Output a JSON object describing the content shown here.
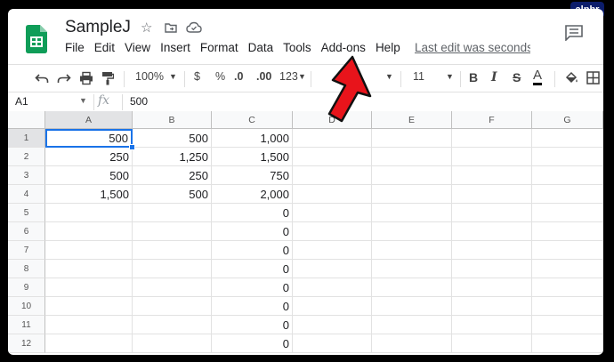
{
  "doc": {
    "title": "SampleJ",
    "last_edit": "Last edit was seconds ago"
  },
  "menu": [
    "File",
    "Edit",
    "View",
    "Insert",
    "Format",
    "Data",
    "Tools",
    "Add-ons",
    "Help"
  ],
  "toolbar": {
    "zoom": "100%",
    "currency": "$",
    "percent": "%",
    "dec_decrease": ".0",
    "dec_increase": ".00",
    "more_formats": "123",
    "font_size": "11",
    "bold": "B",
    "italic": "I",
    "strike": "S",
    "text_color": "A"
  },
  "formula_bar": {
    "name_box": "A1",
    "fx": "fx",
    "value": "500"
  },
  "sheet": {
    "columns": [
      "A",
      "B",
      "C",
      "D",
      "E",
      "F",
      "G"
    ],
    "rows": [
      "1",
      "2",
      "3",
      "4",
      "5",
      "6",
      "7",
      "8",
      "9",
      "10",
      "11",
      "12"
    ],
    "cells": [
      [
        "500",
        "500",
        "1,000"
      ],
      [
        "250",
        "1,250",
        "1,500"
      ],
      [
        "500",
        "250",
        "750"
      ],
      [
        "1,500",
        "500",
        "2,000"
      ],
      [
        "",
        "",
        "0"
      ],
      [
        "",
        "",
        "0"
      ],
      [
        "",
        "",
        "0"
      ],
      [
        "",
        "",
        "0"
      ],
      [
        "",
        "",
        "0"
      ],
      [
        "",
        "",
        "0"
      ],
      [
        "",
        "",
        "0"
      ],
      [
        "",
        "",
        "0"
      ]
    ],
    "active_cell": "A1"
  },
  "watermark": "alphr",
  "colors": {
    "accent": "#1a73e8",
    "logo": "#0f9d58",
    "arrow": "#e8141b"
  }
}
